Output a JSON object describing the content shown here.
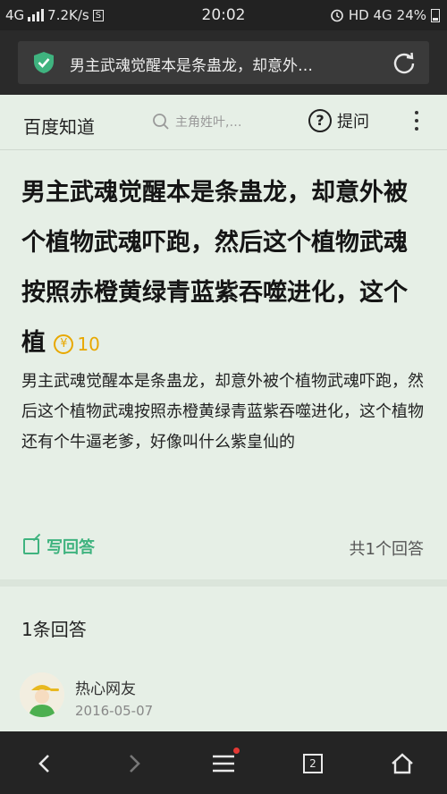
{
  "status_bar": {
    "network": "4G",
    "speed": "7.2K/s",
    "s_badge": "S",
    "time": "20:02",
    "network_right": "HD 4G",
    "battery": "24%"
  },
  "browser": {
    "url_title": "男主武魂觉醒本是条蛊龙，却意外…"
  },
  "header": {
    "logo": "百度知道",
    "search_placeholder": "主角姓叶,…",
    "ask_label": "提问"
  },
  "question": {
    "title": "男主武魂觉醒本是条蛊龙，却意外被个植物武魂吓跑，然后这个植物武魂按照赤橙黄绿青蓝紫吞噬进化，这个植",
    "reward": "10",
    "description": "男主武魂觉醒本是条蛊龙，却意外被个植物武魂吓跑，然后这个植物武魂按照赤橙黄绿青蓝紫吞噬进化，这个植物还有个牛逼老爹，好像叫什么紫皇仙的"
  },
  "actions": {
    "write_answer": "写回答",
    "answer_total": "共1个回答"
  },
  "answers": {
    "count_label": "1条回答",
    "items": [
      {
        "username": "热心网友",
        "date": "2016-05-07"
      }
    ]
  },
  "bottom_nav": {
    "tab_count": "2"
  },
  "colors": {
    "accent_green": "#3fb37f",
    "reward_gold": "#e8a800",
    "background": "#e6efe6"
  }
}
